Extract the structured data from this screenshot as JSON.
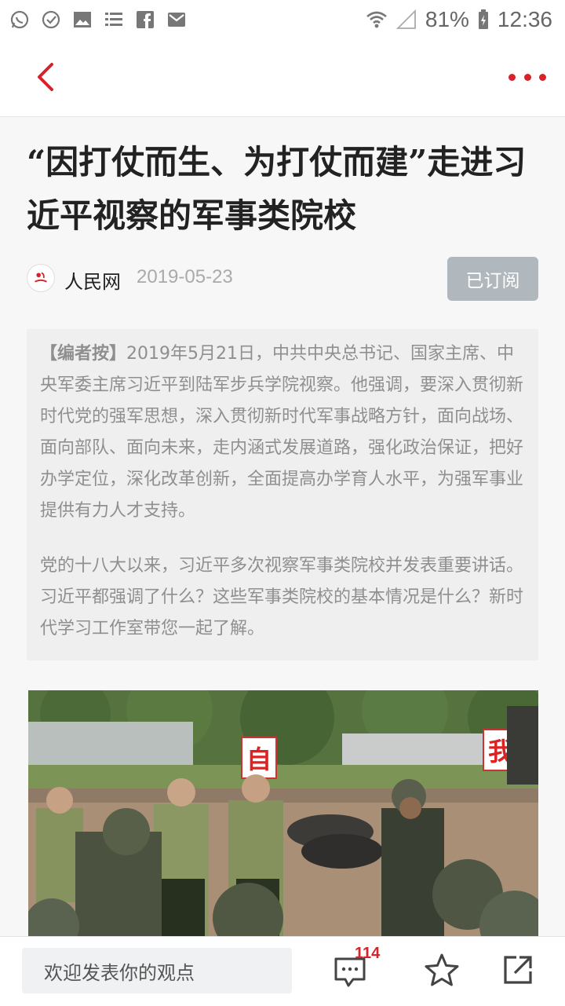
{
  "status_bar": {
    "battery": "81%",
    "time": "12:36",
    "icons": [
      "whatsapp-icon",
      "check-circle-icon",
      "image-icon",
      "list-icon",
      "facebook-icon",
      "mail-icon",
      "wifi-icon",
      "signal-icon",
      "battery-charging-icon"
    ]
  },
  "header": {
    "back_icon": "chevron-left-icon",
    "more_icon": "more-dots-icon",
    "accent_color": "#d8222a"
  },
  "article": {
    "title": "“因打仗而生、为打仗而建”走进习近平视察的军事类院校",
    "source": "人民网",
    "date": "2019-05-23",
    "subscribe_label": "已订阅",
    "editor_tag": "【编者按】",
    "editor_paragraph1": "2019年5月21日，中共中央总书记、国家主席、中央军委主席习近平到陆军步兵学院视察。他强调，要深入贯彻新时代党的强军思想，深入贯彻新时代军事战略方针，面向战场、面向部队、面向未来，走内涵式发展道路，强化政治保证，把好办学定位，深化改革创新，全面提高办学育人水平，为强军事业提供有力人才支持。",
    "editor_paragraph2": "党的十八大以来，习近平多次视察军事类院校并发表重要讲话。习近平都强调了什么？这些军事类院校的基本情况是什么？新时代学习工作室带您一起了解。",
    "photo_signs": [
      "自",
      "我"
    ]
  },
  "bottom_bar": {
    "comment_placeholder": "欢迎发表你的观点",
    "comment_count": "114"
  }
}
